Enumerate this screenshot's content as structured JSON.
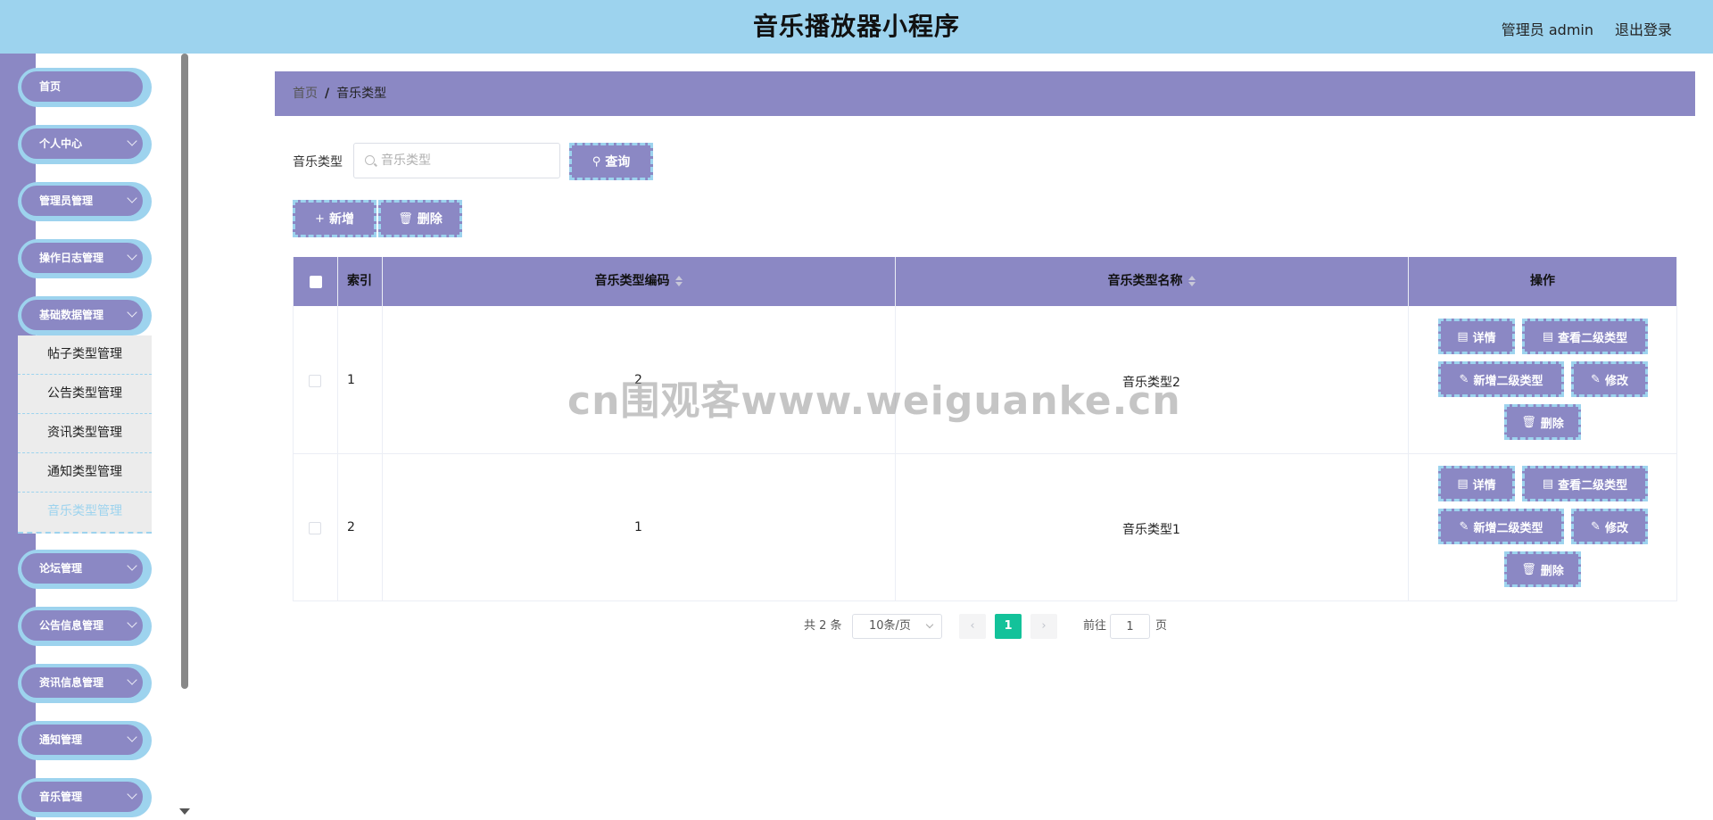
{
  "header": {
    "title": "音乐播放器小程序",
    "user": "管理员 admin",
    "logout": "退出登录"
  },
  "sidebar": {
    "menu": [
      {
        "label": "首页"
      },
      {
        "label": "个人中心"
      },
      {
        "label": "管理员管理"
      },
      {
        "label": "操作日志管理"
      },
      {
        "label": "基础数据管理"
      },
      {
        "label": "论坛管理"
      },
      {
        "label": "公告信息管理"
      },
      {
        "label": "资讯信息管理"
      },
      {
        "label": "通知管理"
      },
      {
        "label": "音乐管理"
      }
    ],
    "submenu": [
      "帖子类型管理",
      "公告类型管理",
      "资讯类型管理",
      "通知类型管理",
      "音乐类型管理"
    ]
  },
  "breadcrumb": {
    "home": "首页",
    "separator": "/",
    "current": "音乐类型"
  },
  "search": {
    "label": "音乐类型",
    "placeholder": "音乐类型",
    "value": "",
    "button": "查询"
  },
  "actions": {
    "add": "新增",
    "delete": "删除"
  },
  "table": {
    "headers": {
      "index": "索引",
      "code": "音乐类型编码",
      "name": "音乐类型名称",
      "ops": "操作"
    },
    "rows": [
      {
        "index": "1",
        "code": "2",
        "name": "音乐类型2"
      },
      {
        "index": "2",
        "code": "1",
        "name": "音乐类型1"
      }
    ],
    "row_actions": {
      "detail": "详情",
      "view_sub": "查看二级类型",
      "add_sub": "新增二级类型",
      "edit": "修改",
      "delete": "删除"
    }
  },
  "pagination": {
    "total": "共 2 条",
    "page_size": "10条/页",
    "current": "1",
    "goto_label": "前往",
    "goto_value": "1",
    "page_suffix": "页"
  },
  "watermark": "cn围观客www.weiguanke.cn",
  "colors": {
    "header_bg": "#9dd3ee",
    "primary": "#8b88c4",
    "accent_dash": "#9dd3ee",
    "active_page": "#13c29a"
  }
}
